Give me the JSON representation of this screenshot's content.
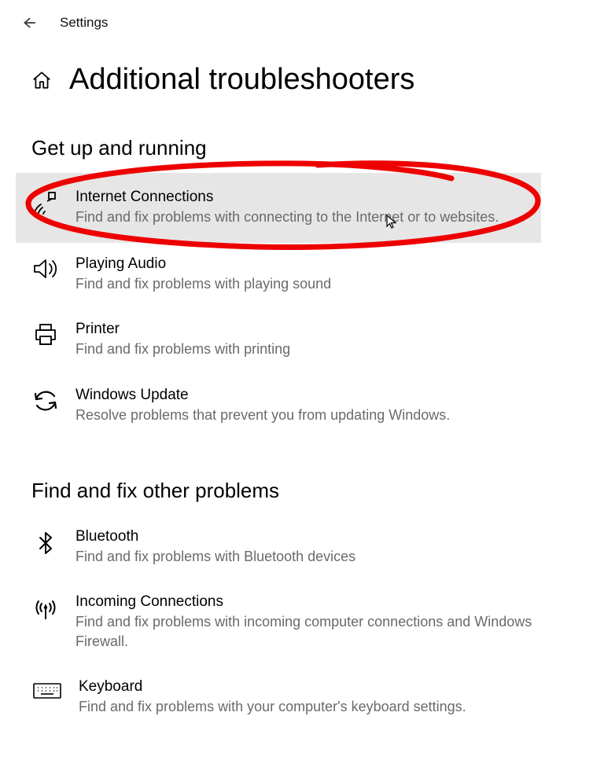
{
  "header": {
    "app_label": "Settings"
  },
  "page": {
    "title": "Additional troubleshooters"
  },
  "sections": [
    {
      "heading": "Get up and running",
      "items": [
        {
          "title": "Internet Connections",
          "description": "Find and fix problems with connecting to the Internet or to websites.",
          "selected": true,
          "annotated": true
        },
        {
          "title": "Playing Audio",
          "description": "Find and fix problems with playing sound"
        },
        {
          "title": "Printer",
          "description": "Find and fix problems with printing"
        },
        {
          "title": "Windows Update",
          "description": "Resolve problems that prevent you from updating Windows."
        }
      ]
    },
    {
      "heading": "Find and fix other problems",
      "items": [
        {
          "title": "Bluetooth",
          "description": "Find and fix problems with Bluetooth devices"
        },
        {
          "title": "Incoming Connections",
          "description": "Find and fix problems with incoming computer connections and Windows Firewall."
        },
        {
          "title": "Keyboard",
          "description": "Find and fix problems with your computer's keyboard settings."
        }
      ]
    }
  ],
  "annotation": {
    "color": "#ee0000"
  }
}
